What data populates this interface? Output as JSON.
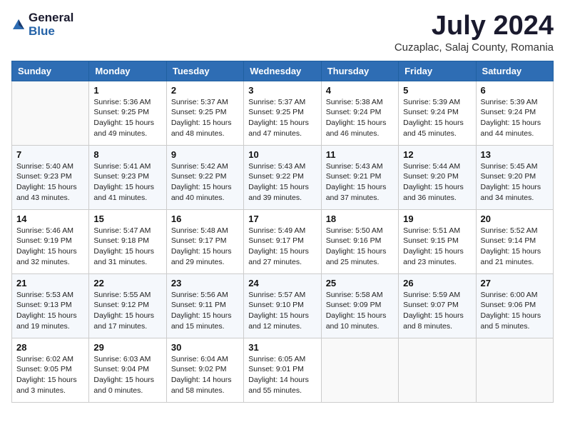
{
  "header": {
    "logo_general": "General",
    "logo_blue": "Blue",
    "month_title": "July 2024",
    "location": "Cuzaplac, Salaj County, Romania"
  },
  "weekdays": [
    "Sunday",
    "Monday",
    "Tuesday",
    "Wednesday",
    "Thursday",
    "Friday",
    "Saturday"
  ],
  "weeks": [
    [
      {
        "day": "",
        "content": ""
      },
      {
        "day": "1",
        "content": "Sunrise: 5:36 AM\nSunset: 9:25 PM\nDaylight: 15 hours\nand 49 minutes."
      },
      {
        "day": "2",
        "content": "Sunrise: 5:37 AM\nSunset: 9:25 PM\nDaylight: 15 hours\nand 48 minutes."
      },
      {
        "day": "3",
        "content": "Sunrise: 5:37 AM\nSunset: 9:25 PM\nDaylight: 15 hours\nand 47 minutes."
      },
      {
        "day": "4",
        "content": "Sunrise: 5:38 AM\nSunset: 9:24 PM\nDaylight: 15 hours\nand 46 minutes."
      },
      {
        "day": "5",
        "content": "Sunrise: 5:39 AM\nSunset: 9:24 PM\nDaylight: 15 hours\nand 45 minutes."
      },
      {
        "day": "6",
        "content": "Sunrise: 5:39 AM\nSunset: 9:24 PM\nDaylight: 15 hours\nand 44 minutes."
      }
    ],
    [
      {
        "day": "7",
        "content": "Sunrise: 5:40 AM\nSunset: 9:23 PM\nDaylight: 15 hours\nand 43 minutes."
      },
      {
        "day": "8",
        "content": "Sunrise: 5:41 AM\nSunset: 9:23 PM\nDaylight: 15 hours\nand 41 minutes."
      },
      {
        "day": "9",
        "content": "Sunrise: 5:42 AM\nSunset: 9:22 PM\nDaylight: 15 hours\nand 40 minutes."
      },
      {
        "day": "10",
        "content": "Sunrise: 5:43 AM\nSunset: 9:22 PM\nDaylight: 15 hours\nand 39 minutes."
      },
      {
        "day": "11",
        "content": "Sunrise: 5:43 AM\nSunset: 9:21 PM\nDaylight: 15 hours\nand 37 minutes."
      },
      {
        "day": "12",
        "content": "Sunrise: 5:44 AM\nSunset: 9:20 PM\nDaylight: 15 hours\nand 36 minutes."
      },
      {
        "day": "13",
        "content": "Sunrise: 5:45 AM\nSunset: 9:20 PM\nDaylight: 15 hours\nand 34 minutes."
      }
    ],
    [
      {
        "day": "14",
        "content": "Sunrise: 5:46 AM\nSunset: 9:19 PM\nDaylight: 15 hours\nand 32 minutes."
      },
      {
        "day": "15",
        "content": "Sunrise: 5:47 AM\nSunset: 9:18 PM\nDaylight: 15 hours\nand 31 minutes."
      },
      {
        "day": "16",
        "content": "Sunrise: 5:48 AM\nSunset: 9:17 PM\nDaylight: 15 hours\nand 29 minutes."
      },
      {
        "day": "17",
        "content": "Sunrise: 5:49 AM\nSunset: 9:17 PM\nDaylight: 15 hours\nand 27 minutes."
      },
      {
        "day": "18",
        "content": "Sunrise: 5:50 AM\nSunset: 9:16 PM\nDaylight: 15 hours\nand 25 minutes."
      },
      {
        "day": "19",
        "content": "Sunrise: 5:51 AM\nSunset: 9:15 PM\nDaylight: 15 hours\nand 23 minutes."
      },
      {
        "day": "20",
        "content": "Sunrise: 5:52 AM\nSunset: 9:14 PM\nDaylight: 15 hours\nand 21 minutes."
      }
    ],
    [
      {
        "day": "21",
        "content": "Sunrise: 5:53 AM\nSunset: 9:13 PM\nDaylight: 15 hours\nand 19 minutes."
      },
      {
        "day": "22",
        "content": "Sunrise: 5:55 AM\nSunset: 9:12 PM\nDaylight: 15 hours\nand 17 minutes."
      },
      {
        "day": "23",
        "content": "Sunrise: 5:56 AM\nSunset: 9:11 PM\nDaylight: 15 hours\nand 15 minutes."
      },
      {
        "day": "24",
        "content": "Sunrise: 5:57 AM\nSunset: 9:10 PM\nDaylight: 15 hours\nand 12 minutes."
      },
      {
        "day": "25",
        "content": "Sunrise: 5:58 AM\nSunset: 9:09 PM\nDaylight: 15 hours\nand 10 minutes."
      },
      {
        "day": "26",
        "content": "Sunrise: 5:59 AM\nSunset: 9:07 PM\nDaylight: 15 hours\nand 8 minutes."
      },
      {
        "day": "27",
        "content": "Sunrise: 6:00 AM\nSunset: 9:06 PM\nDaylight: 15 hours\nand 5 minutes."
      }
    ],
    [
      {
        "day": "28",
        "content": "Sunrise: 6:02 AM\nSunset: 9:05 PM\nDaylight: 15 hours\nand 3 minutes."
      },
      {
        "day": "29",
        "content": "Sunrise: 6:03 AM\nSunset: 9:04 PM\nDaylight: 15 hours\nand 0 minutes."
      },
      {
        "day": "30",
        "content": "Sunrise: 6:04 AM\nSunset: 9:02 PM\nDaylight: 14 hours\nand 58 minutes."
      },
      {
        "day": "31",
        "content": "Sunrise: 6:05 AM\nSunset: 9:01 PM\nDaylight: 14 hours\nand 55 minutes."
      },
      {
        "day": "",
        "content": ""
      },
      {
        "day": "",
        "content": ""
      },
      {
        "day": "",
        "content": ""
      }
    ]
  ]
}
